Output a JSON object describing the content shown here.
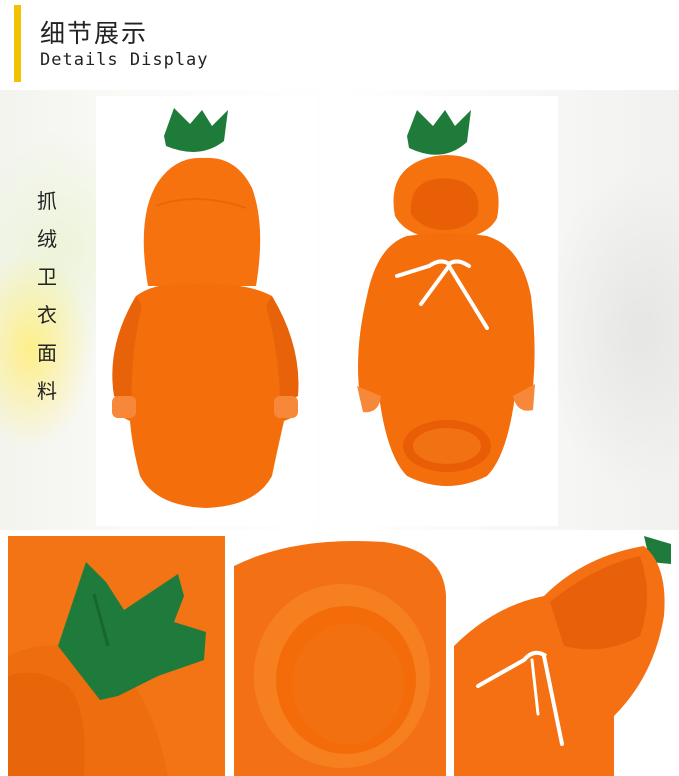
{
  "header": {
    "title_cn": "细节展示",
    "title_en": "Details Display"
  },
  "side_label": {
    "chars": [
      "抓",
      "绒",
      "卫",
      "衣",
      "面",
      "料"
    ]
  },
  "colors": {
    "accent_bar": "#f2c200",
    "hoodie_orange": "#f5720f",
    "stem_green": "#1e7b3a",
    "drawstring_white": "#ffffff"
  }
}
